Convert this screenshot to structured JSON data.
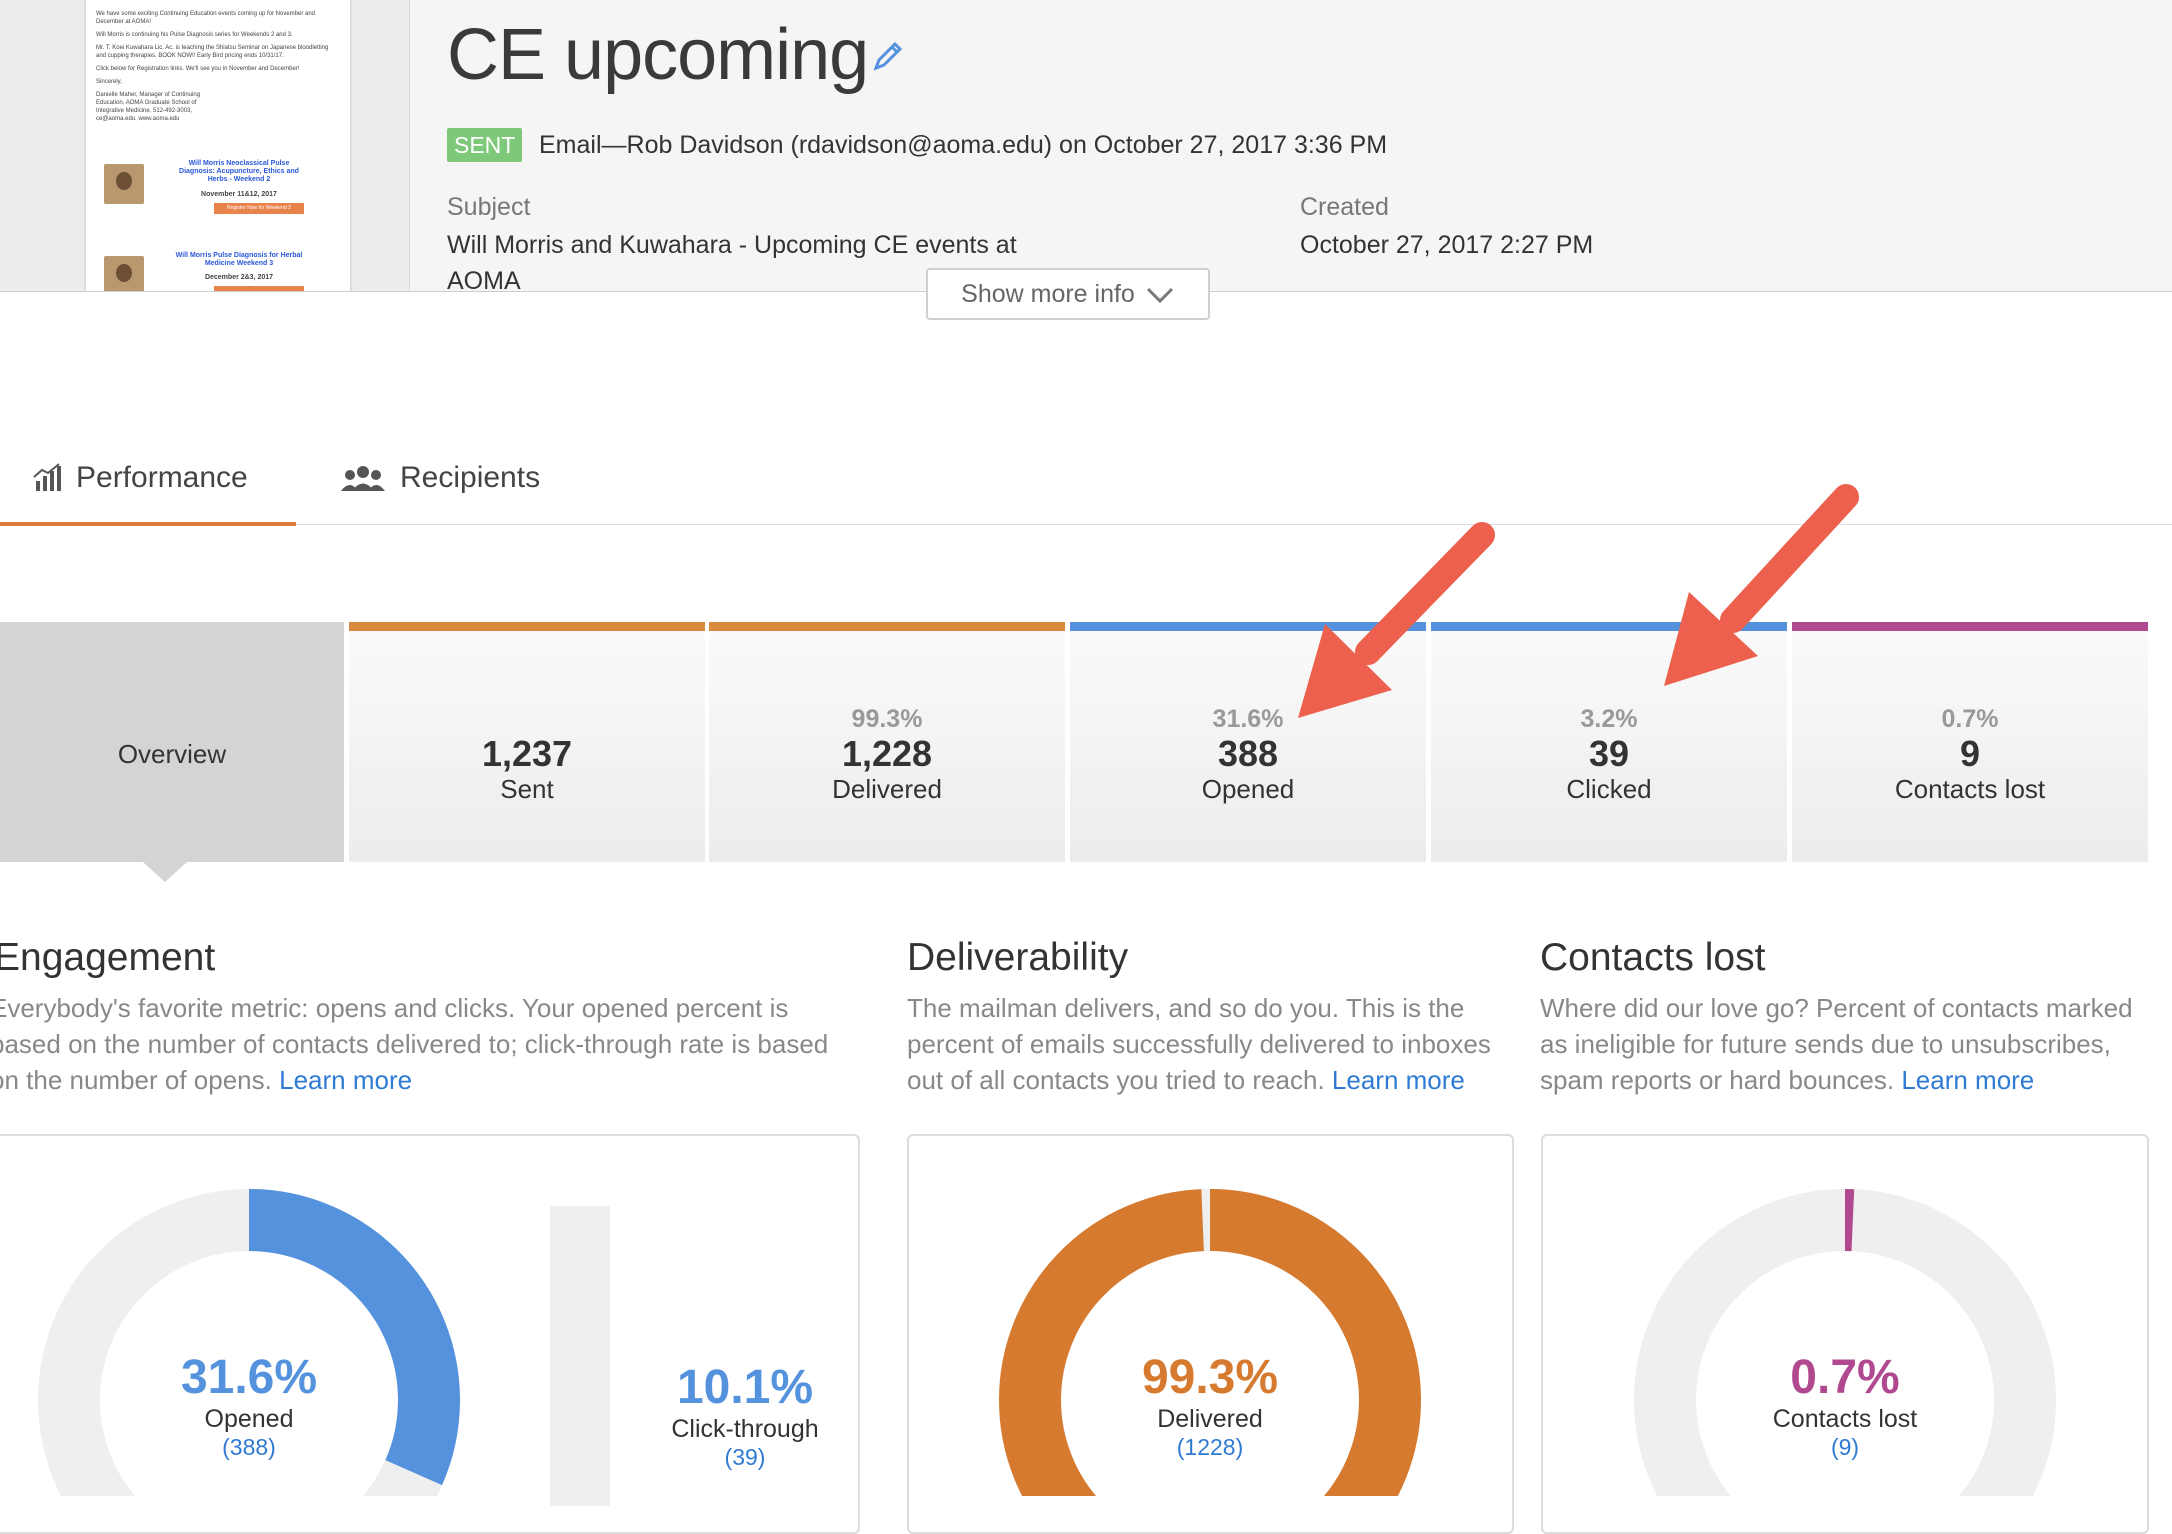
{
  "header": {
    "title": "CE upcoming",
    "status_badge": "SENT",
    "sent_info": "Email—Rob Davidson (rdavidson@aoma.edu) on October 27, 2017 3:36 PM",
    "subject_label": "Subject",
    "subject_line1": "Will Morris and Kuwahara - Upcoming CE events at",
    "subject_line2": "AOMA",
    "created_label": "Created",
    "created_value": "October 27, 2017 2:27 PM",
    "show_more": "Show more info"
  },
  "preview": {
    "line1": "We have some exciting Continuing Education events coming up for November and December at AOMA!",
    "line2": "Will Morris is continuing his Pulse Diagnosis series for Weekends 2 and 3.",
    "line3": "Mr. T. Koei Kuwahara Lic. Ac. is teaching the Shiatsu Seminar on Japanese bloodletting and cupping therapies. BOOK NOW!! Early Bird pricing ends 10/31/17.",
    "line4": "Click below for Registration links. We'll see you in November and December!",
    "line5": "Sincerely,",
    "signature": "Danielle Maher, Manager of Continuing Education, AOMA Graduate School of Integrative Medicine, 512-492-3003, ce@aoma.edu, www.aoma.edu",
    "item1_title": "Will Morris Neoclassical Pulse Diagnosis: Acupuncture, Ethics and Herbs - Weekend 2",
    "item1_date": "November 11&12, 2017",
    "item1_button": "Register Now for Weekend 2",
    "item2_title": "Will Morris Pulse Diagnosis for Herbal Medicine Weekend 3",
    "item2_date": "December 2&3, 2017"
  },
  "tabs": [
    {
      "label": "Performance",
      "icon": "bar-chart-icon"
    },
    {
      "label": "Recipients",
      "icon": "people-icon"
    }
  ],
  "stats": {
    "overview": "Overview",
    "sent": {
      "value": "1,237",
      "label": "Sent"
    },
    "delivered": {
      "pct": "99.3%",
      "value": "1,228",
      "label": "Delivered"
    },
    "opened": {
      "pct": "31.6%",
      "value": "388",
      "label": "Opened"
    },
    "clicked": {
      "pct": "3.2%",
      "value": "39",
      "label": "Clicked"
    },
    "lost": {
      "pct": "0.7%",
      "value": "9",
      "label": "Contacts lost"
    }
  },
  "engagement": {
    "title": "Engagement",
    "desc_line1": "Everybody's favorite metric: opens and clicks. Your opened percent is",
    "desc_line2": "based on the number of contacts delivered to; click-through rate is based",
    "desc_line3": "on the number of opens.",
    "learn_more": "Learn more",
    "ring_pct": "31.6%",
    "ring_label": "Opened",
    "ring_count": "(388)",
    "opened_fraction": 0.316,
    "ct_pct": "10.1%",
    "ct_label": "Click-through",
    "ct_count": "(39)"
  },
  "deliverability": {
    "title": "Deliverability",
    "desc_line1": "The mailman delivers, and so do you. This is the",
    "desc_line2": "percent of emails successfully delivered to inboxes",
    "desc_line3": "out of all contacts you tried to reach.",
    "learn_more": "Learn more",
    "ring_pct": "99.3%",
    "ring_label": "Delivered",
    "ring_count": "(1228)",
    "delivered_fraction": 0.993
  },
  "contacts_lost": {
    "title": "Contacts lost",
    "desc_line1": "Where did our love go? Percent of contacts marked",
    "desc_line2": "as ineligible for future sends due to unsubscribes,",
    "desc_line3": "spam reports or hard bounces.",
    "learn_more": "Learn more",
    "ring_pct": "0.7%",
    "ring_label": "Contacts lost",
    "ring_count": "(9)",
    "lost_fraction": 0.007
  },
  "colors": {
    "orange": "#d67a2f",
    "blue": "#5592dd",
    "purple": "#b0498f",
    "green": "#7ec87a",
    "link": "#2f7bd4",
    "annotation_arrow": "#ec604d"
  }
}
